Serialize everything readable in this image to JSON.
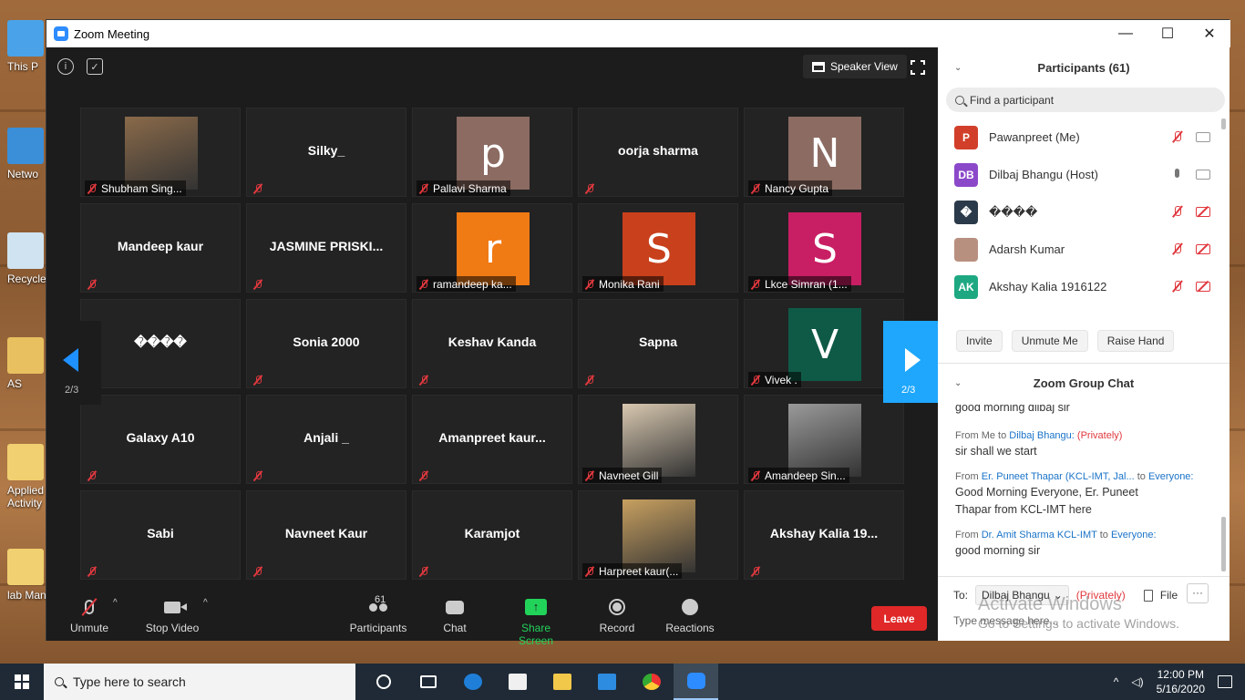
{
  "desktop": {
    "icons": [
      {
        "label": "This P"
      },
      {
        "label": "Netwo"
      },
      {
        "label": "Recycle"
      },
      {
        "label": "AS"
      },
      {
        "label": "Applied Activity"
      },
      {
        "label": "lab Manu"
      }
    ]
  },
  "window": {
    "title": "Zoom Meeting",
    "controls": [
      "—",
      "☐",
      "✕"
    ]
  },
  "video": {
    "speaker_view_label": "Speaker View",
    "page_left": "2/3",
    "page_right": "2/3",
    "tiles": [
      {
        "name": "",
        "label": "Shubham Sing...",
        "kind": "photo",
        "color": "#8a6a4a"
      },
      {
        "name": "Silky_",
        "label": "",
        "kind": "name"
      },
      {
        "name": "",
        "label": "Pallavi Sharma",
        "kind": "letter",
        "letter": "p",
        "color": "#8c6b62"
      },
      {
        "name": "oorja sharma",
        "label": "",
        "kind": "name"
      },
      {
        "name": "",
        "label": "Nancy Gupta",
        "kind": "letter",
        "letter": "N",
        "color": "#8c6b62"
      },
      {
        "name": "Mandeep kaur",
        "label": "",
        "kind": "name"
      },
      {
        "name": "JASMINE  PRISKI...",
        "label": "",
        "kind": "name"
      },
      {
        "name": "",
        "label": "ramandeep ka...",
        "kind": "letter",
        "letter": "r",
        "color": "#f07a14"
      },
      {
        "name": "",
        "label": "Monika Rani",
        "kind": "letter",
        "letter": "S",
        "color": "#c8401c"
      },
      {
        "name": "",
        "label": "Lkce Simran (1...",
        "kind": "letter",
        "letter": "S",
        "color": "#c81e64"
      },
      {
        "name": "����",
        "label": "",
        "kind": "name"
      },
      {
        "name": "Sonia 2000",
        "label": "",
        "kind": "name"
      },
      {
        "name": "Keshav Kanda",
        "label": "",
        "kind": "name"
      },
      {
        "name": "Sapna",
        "label": "",
        "kind": "name"
      },
      {
        "name": "",
        "label": "Vivek .",
        "kind": "letter",
        "letter": "V",
        "color": "#0f5a46"
      },
      {
        "name": "Galaxy A10",
        "label": "",
        "kind": "name"
      },
      {
        "name": "Anjali _",
        "label": "",
        "kind": "name"
      },
      {
        "name": "Amanpreet  kaur...",
        "label": "",
        "kind": "name"
      },
      {
        "name": "",
        "label": "Navneet Gill",
        "kind": "photo",
        "color": "#d8c8b0"
      },
      {
        "name": "",
        "label": "Amandeep Sin...",
        "kind": "photo",
        "color": "#9a9a9a"
      },
      {
        "name": "Sabi",
        "label": "",
        "kind": "name"
      },
      {
        "name": "Navneet Kaur",
        "label": "",
        "kind": "name"
      },
      {
        "name": "Karamjot",
        "label": "",
        "kind": "name"
      },
      {
        "name": "",
        "label": "Harpreet kaur(...",
        "kind": "photo",
        "color": "#c8a060"
      },
      {
        "name": "Akshay Kalia 19...",
        "label": "",
        "kind": "name"
      }
    ]
  },
  "toolbar": {
    "unmute": "Unmute",
    "stop_video": "Stop Video",
    "participants": "Participants",
    "participants_count": "61",
    "chat": "Chat",
    "share_screen": "Share Screen",
    "record": "Record",
    "reactions": "Reactions",
    "leave": "Leave"
  },
  "participants": {
    "header": "Participants (61)",
    "search_placeholder": "Find a participant",
    "list": [
      {
        "initials": "P",
        "name": "Pawanpreet (Me)",
        "color": "#d13f2a",
        "mic": "off",
        "cam": "on"
      },
      {
        "initials": "DB",
        "name": "Dilbaj Bhangu (Host)",
        "color": "#8b49c9",
        "mic": "on",
        "cam": "on"
      },
      {
        "initials": "�",
        "name": "����",
        "color": "#2b3a4a",
        "mic": "off",
        "cam": "off"
      },
      {
        "initials": "",
        "name": "Adarsh Kumar",
        "color": "#b89080",
        "mic": "off",
        "cam": "off"
      },
      {
        "initials": "AK",
        "name": "Akshay Kalia 1916122",
        "color": "#1ea882",
        "mic": "off",
        "cam": "off"
      }
    ],
    "actions": [
      "Invite",
      "Unmute Me",
      "Raise Hand"
    ]
  },
  "chat": {
    "header": "Zoom Group Chat",
    "partial_top": "good morning dilbaj sir",
    "messages": [
      {
        "from": "From Me to ",
        "to": "Dilbaj Bhangu:",
        "private": " (Privately)",
        "body": "sir shall we start"
      },
      {
        "from": "From ",
        "sender": "Er. Puneet Thapar (KCL-IMT, Jal...",
        "mid": " to ",
        "to": "Everyone:",
        "body": "Good Morning Everyone, Er. Puneet Thapar from KCL-IMT here"
      },
      {
        "from": "From ",
        "sender": "Dr. Amit Sharma KCL-IMT",
        "mid": " to ",
        "to": "Everyone:",
        "body": "good morning sir"
      }
    ],
    "to_label": "To:",
    "to_value": "Dilbaj Bhangu",
    "to_private": "(Privately)",
    "file_label": "File",
    "more_label": "···",
    "input_placeholder": "Type message here..."
  },
  "watermark": {
    "line1": "Activate Windows",
    "line2": "Go to Settings to activate Windows."
  },
  "taskbar": {
    "search_placeholder": "Type here to search",
    "time": "12:00 PM",
    "date": "5/16/2020"
  }
}
